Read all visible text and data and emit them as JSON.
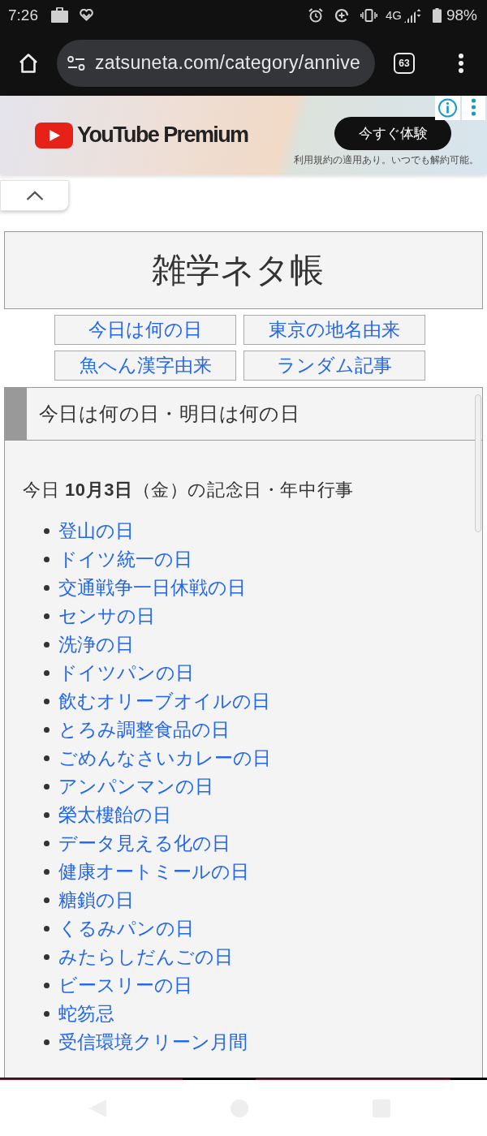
{
  "status_bar": {
    "time": "7:26",
    "network": "4G",
    "battery": "98%"
  },
  "browser": {
    "url": "zatsuneta.com/category/annive",
    "tab_count": "63"
  },
  "ad": {
    "brand": "YouTube Premium",
    "button": "今すぐ体験",
    "disclaimer": "利用規約の適用あり。いつでも解約可能。"
  },
  "site": {
    "title": "雑学ネタ帳",
    "nav_links": [
      "今日は何の日",
      "東京の地名由来",
      "魚へん漢字由来",
      "ランダム記事"
    ]
  },
  "section": {
    "heading": "今日は何の日・明日は何の日",
    "date_line": "今日 **10月3日**（金）の記念日・年中行事",
    "items": [
      "登山の日",
      "ドイツ統一の日",
      "交通戦争一日休戦の日",
      "センサの日",
      "洗浄の日",
      "ドイツパンの日",
      "飲むオリーブオイルの日",
      "とろみ調整食品の日",
      "ごめんなさいカレーの日",
      "アンパンマンの日",
      "榮太樓飴の日",
      "データ見える化の日",
      "健康オートミールの日",
      "糖鎖の日",
      "くるみパンの日",
      "みたらしだんごの日",
      "ビースリーの日",
      "蛇笏忌",
      "受信環境クリーン月間"
    ]
  }
}
